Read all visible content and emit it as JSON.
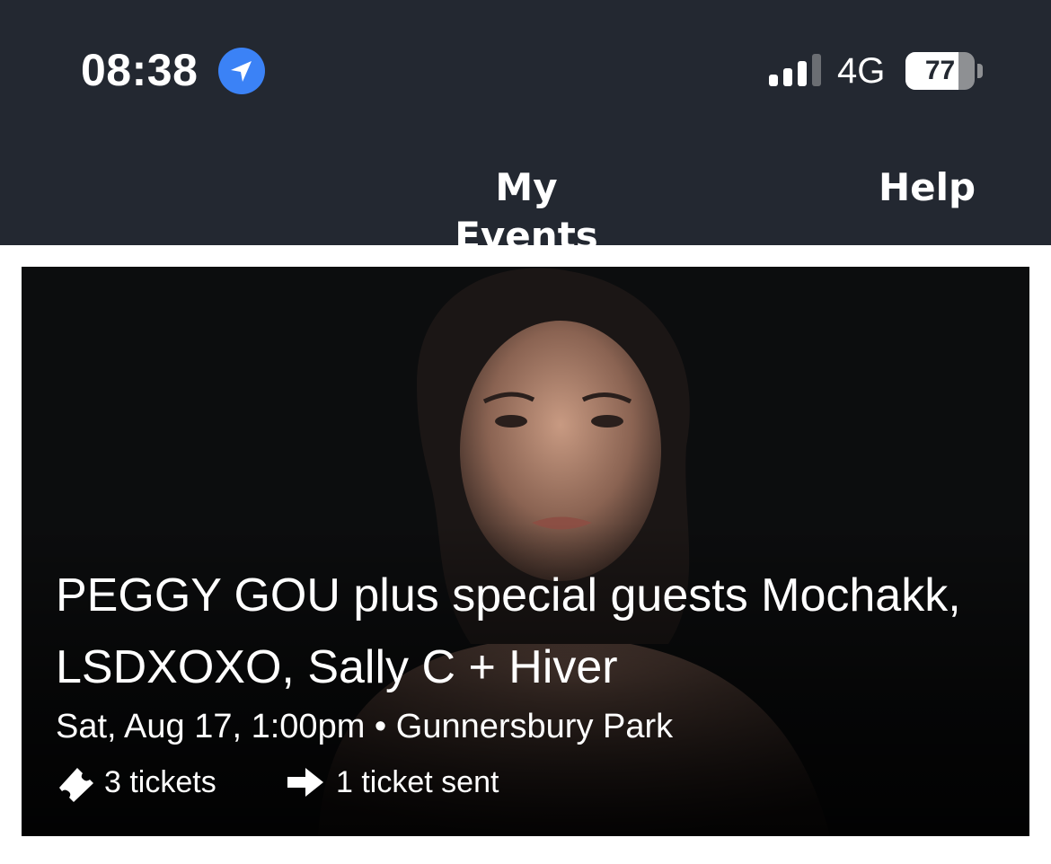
{
  "status_bar": {
    "time": "08:38",
    "location_icon": "location-arrow-icon",
    "signal_icon": "cellular-signal-icon",
    "network": "4G",
    "battery_level": "77",
    "battery_fraction": 0.77
  },
  "nav": {
    "title": "My Events",
    "help_label": "Help"
  },
  "colors": {
    "header_background": "#232831",
    "location_blue": "#3b82f6",
    "text": "#ffffff"
  },
  "event": {
    "title": "PEGGY GOU plus special guests Mochakk, LSDXOXO, Sally C + Hiver",
    "date_venue": "Sat, Aug 17, 1:00pm • Gunnersbury Park",
    "ticket_icon": "ticket-icon",
    "tickets_label": "3 tickets",
    "sent_icon": "arrow-right-icon",
    "sent_label": "1 ticket sent"
  }
}
